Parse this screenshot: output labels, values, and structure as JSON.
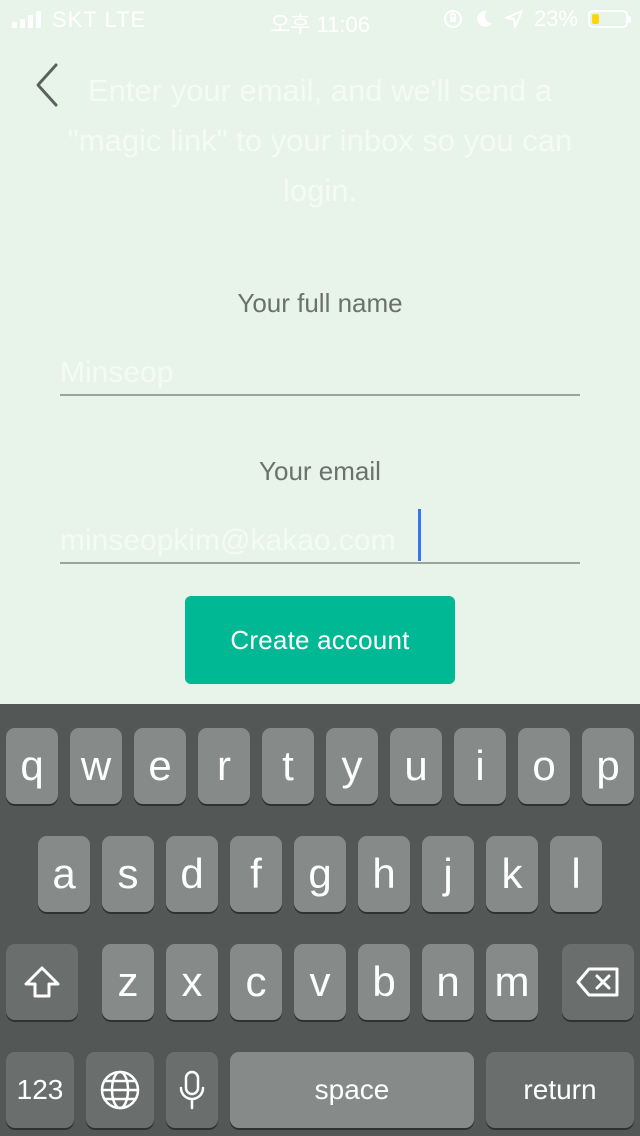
{
  "status_bar": {
    "carrier": "SKT  LTE",
    "time": "오후 11:06",
    "battery": "23%",
    "battery_level": 0.23,
    "icons": [
      "signal-icon",
      "orientation-lock-icon",
      "moon-icon",
      "location-icon",
      "battery-icon"
    ]
  },
  "header": {
    "back_icon": "chevron-left-icon",
    "intro": "Enter your email, and we'll send a \"magic link\" to your inbox so you can login."
  },
  "form": {
    "name_label": "Your full name",
    "name_value": "Minseop",
    "email_label": "Your email",
    "email_value": "minseopkim@kakao.com",
    "submit_label": "Create account"
  },
  "colors": {
    "background": "#e8f3ea",
    "accent": "#00b894",
    "caret": "#3478f6",
    "keyboard": "#535856"
  },
  "keyboard": {
    "row1": [
      "q",
      "w",
      "e",
      "r",
      "t",
      "y",
      "u",
      "i",
      "o",
      "p"
    ],
    "row2": [
      "a",
      "s",
      "d",
      "f",
      "g",
      "h",
      "j",
      "k",
      "l"
    ],
    "row3": [
      "z",
      "x",
      "c",
      "v",
      "b",
      "n",
      "m"
    ],
    "numbers_label": "123",
    "space_label": "space",
    "return_label": "return",
    "icons": [
      "shift-icon",
      "backspace-icon",
      "globe-icon",
      "microphone-icon"
    ]
  }
}
